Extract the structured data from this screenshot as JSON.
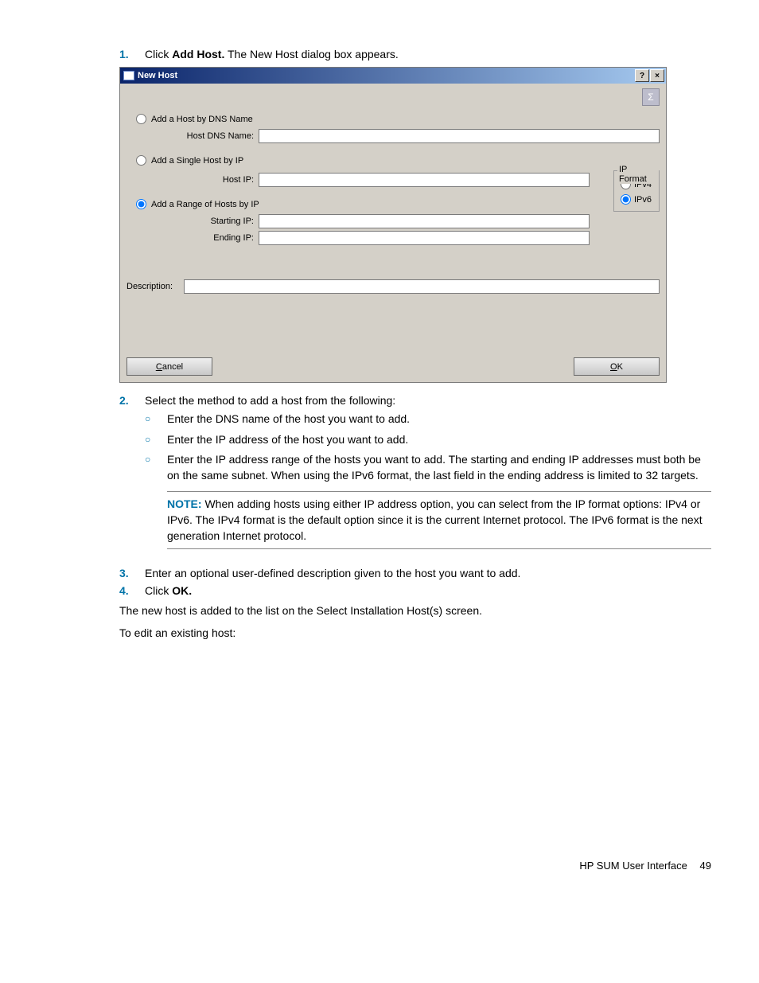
{
  "step1": {
    "num": "1.",
    "pre": "Click ",
    "bold": "Add Host.",
    "post": " The New Host dialog box appears."
  },
  "dialog": {
    "title": "New Host",
    "helpBtn": "?",
    "closeBtn": "×",
    "sigma": "Σ",
    "radio_dns": "Add a Host by DNS Name",
    "label_hostdns": "Host DNS Name:",
    "radio_single": "Add a Single Host by IP",
    "label_hostip": "Host IP:",
    "radio_range": "Add a Range of Hosts by IP",
    "label_startip": "Starting IP:",
    "label_endip": "Ending IP:",
    "ipformat_legend": "IP Format",
    "ipformat_v4": "IPv4",
    "ipformat_v6": "IPv6",
    "label_desc": "Description:",
    "btn_cancel_u": "C",
    "btn_cancel_rest": "ancel",
    "btn_ok_u": "O",
    "btn_ok_rest": "K"
  },
  "step2": {
    "num": "2.",
    "text": "Select the method to add a host from the following:",
    "sub1": "Enter the DNS name of the host you want to add.",
    "sub2": "Enter the IP address of the host you want to add.",
    "sub3": "Enter the IP address range of the hosts you want to add. The starting and ending IP addresses must both be on the same subnet. When using the IPv6 format, the last field in the ending address is limited to 32 targets.",
    "note_label": "NOTE:",
    "note_text": "  When adding hosts using either IP address option, you can select from the IP format options: IPv4 or IPv6. The IPv4 format is the default option since it is the current Internet protocol. The IPv6 format is the next generation Internet protocol."
  },
  "step3": {
    "num": "3.",
    "text": "Enter an optional user-defined description given to the host you want to add."
  },
  "step4": {
    "num": "4.",
    "pre": "Click ",
    "bold": "OK."
  },
  "para1": "The new host is added to the list on the Select Installation Host(s) screen.",
  "para2": "To edit an existing host:",
  "footer_text": "HP SUM User Interface",
  "footer_page": "49"
}
